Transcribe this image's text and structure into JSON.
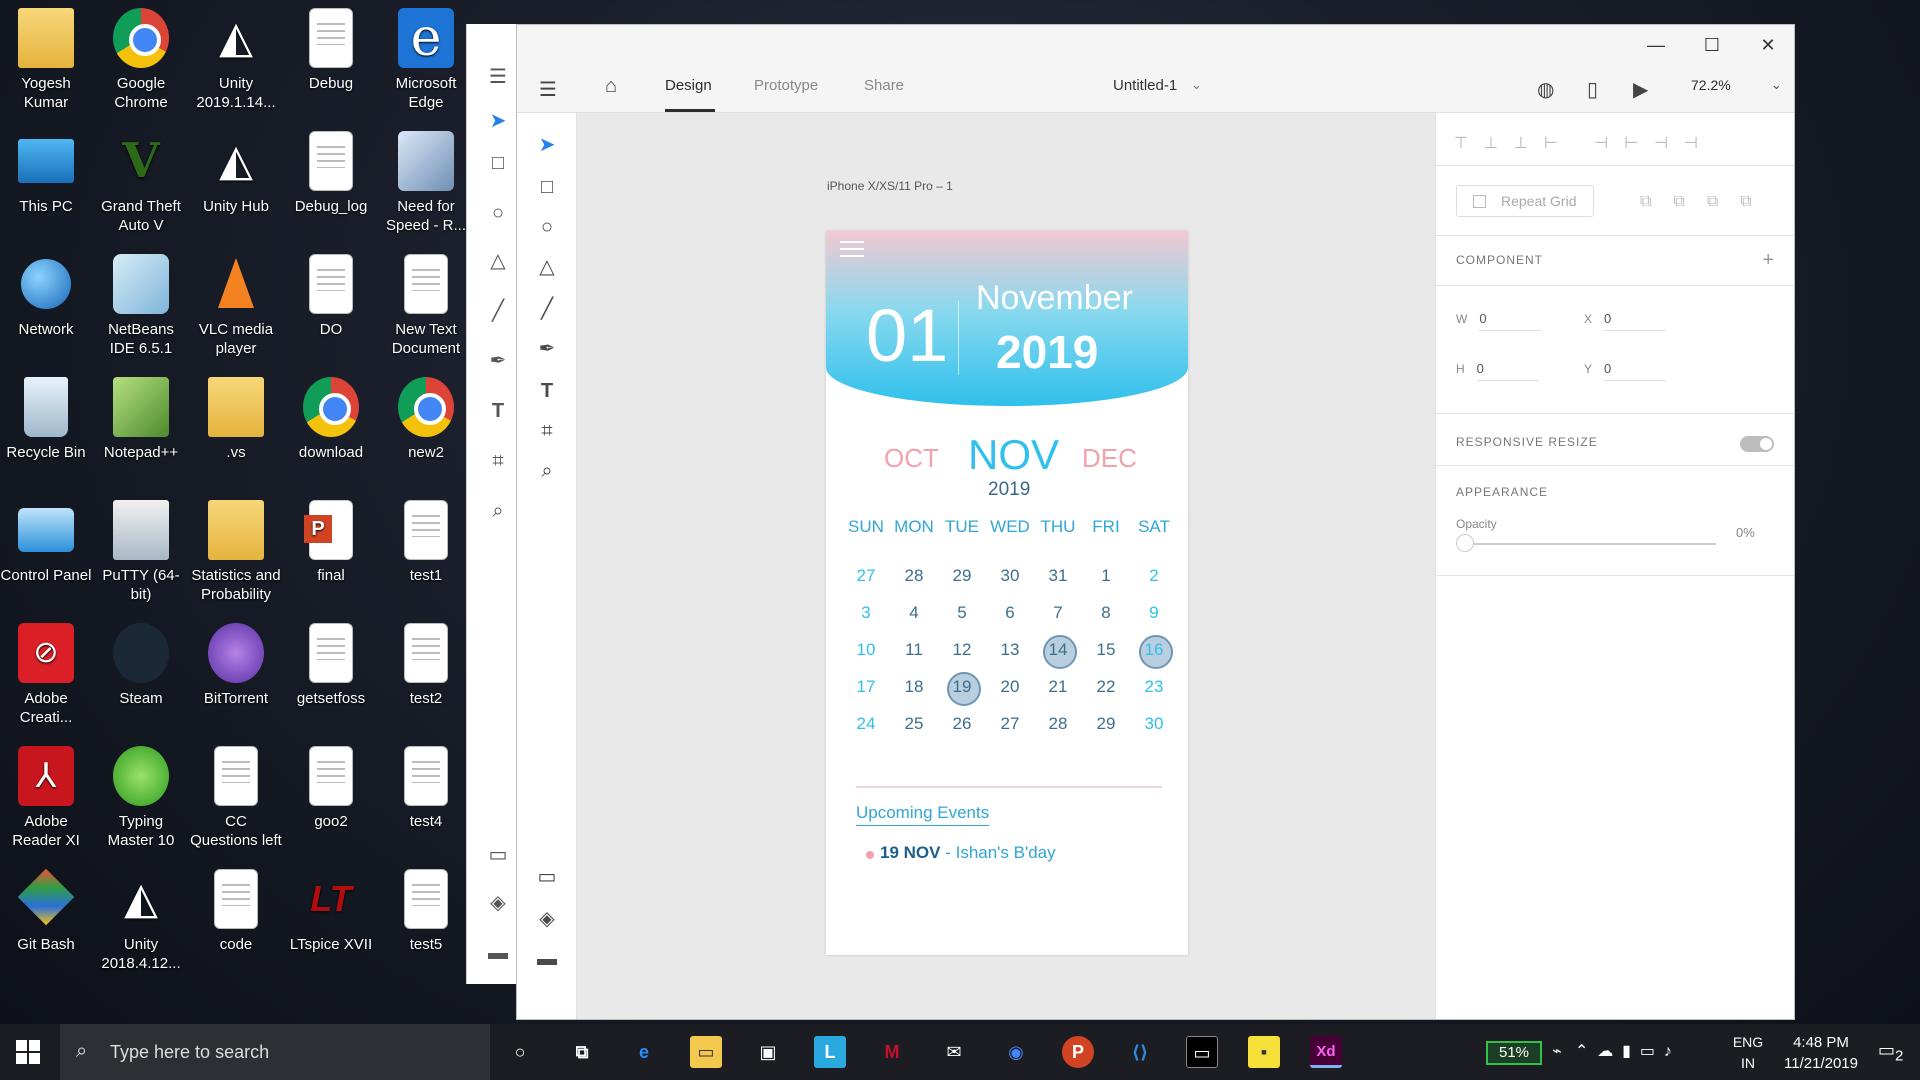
{
  "desktop": {
    "icons": [
      {
        "label": "Yogesh Kumar",
        "icon": "user-folder-icon",
        "col": 0,
        "row": 0
      },
      {
        "label": "Google Chrome",
        "icon": "chrome-icon",
        "col": 1,
        "row": 0
      },
      {
        "label": "Unity 2019.1.14...",
        "icon": "unity-icon",
        "col": 2,
        "row": 0
      },
      {
        "label": "Debug",
        "icon": "document-icon",
        "col": 3,
        "row": 0
      },
      {
        "label": "Microsoft Edge",
        "icon": "edge-icon",
        "col": 4,
        "row": 0
      },
      {
        "label": "This PC",
        "icon": "pc-icon",
        "col": 0,
        "row": 1
      },
      {
        "label": "Grand Theft Auto V",
        "icon": "gta-icon",
        "col": 1,
        "row": 1
      },
      {
        "label": "Unity Hub",
        "icon": "unity-icon",
        "col": 2,
        "row": 1
      },
      {
        "label": "Debug_log",
        "icon": "document-icon",
        "col": 3,
        "row": 1
      },
      {
        "label": "Need for Speed - R...",
        "icon": "nfs-icon",
        "col": 4,
        "row": 1
      },
      {
        "label": "Network",
        "icon": "network-icon",
        "col": 0,
        "row": 2
      },
      {
        "label": "NetBeans IDE 6.5.1",
        "icon": "netbeans-icon",
        "col": 1,
        "row": 2
      },
      {
        "label": "VLC media player",
        "icon": "vlc-icon",
        "col": 2,
        "row": 2
      },
      {
        "label": "DO",
        "icon": "document-icon",
        "col": 3,
        "row": 2
      },
      {
        "label": "New Text Document",
        "icon": "document-icon",
        "col": 4,
        "row": 2
      },
      {
        "label": "Recycle Bin",
        "icon": "recycle-bin-icon",
        "col": 0,
        "row": 3
      },
      {
        "label": "Notepad++",
        "icon": "notepadpp-icon",
        "col": 1,
        "row": 3
      },
      {
        "label": ".vs",
        "icon": "folder-icon",
        "col": 2,
        "row": 3
      },
      {
        "label": "download",
        "icon": "chrome-icon",
        "col": 3,
        "row": 3
      },
      {
        "label": "new2",
        "icon": "chrome-icon",
        "col": 4,
        "row": 3
      },
      {
        "label": "Control Panel",
        "icon": "control-panel-icon",
        "col": 0,
        "row": 4
      },
      {
        "label": "PuTTY (64-bit)",
        "icon": "putty-icon",
        "col": 1,
        "row": 4
      },
      {
        "label": "Statistics and Probability",
        "icon": "folder-icon",
        "col": 2,
        "row": 4
      },
      {
        "label": "final",
        "icon": "powerpoint-icon",
        "col": 3,
        "row": 4
      },
      {
        "label": "test1",
        "icon": "document-icon",
        "col": 4,
        "row": 4
      },
      {
        "label": "Adobe Creati...",
        "icon": "adobe-cc-icon",
        "col": 0,
        "row": 5
      },
      {
        "label": "Steam",
        "icon": "steam-icon",
        "col": 1,
        "row": 5
      },
      {
        "label": "BitTorrent",
        "icon": "bittorrent-icon",
        "col": 2,
        "row": 5
      },
      {
        "label": "getsetfoss",
        "icon": "document-icon",
        "col": 3,
        "row": 5
      },
      {
        "label": "test2",
        "icon": "document-icon",
        "col": 4,
        "row": 5
      },
      {
        "label": "Adobe Reader XI",
        "icon": "adobe-reader-icon",
        "col": 0,
        "row": 6
      },
      {
        "label": "Typing Master 10",
        "icon": "typing-master-icon",
        "col": 1,
        "row": 6
      },
      {
        "label": "CC Questions left",
        "icon": "document-icon",
        "col": 2,
        "row": 6
      },
      {
        "label": "goo2",
        "icon": "document-icon",
        "col": 3,
        "row": 6
      },
      {
        "label": "test4",
        "icon": "document-icon",
        "col": 4,
        "row": 6
      },
      {
        "label": "Git Bash",
        "icon": "git-icon",
        "col": 0,
        "row": 7
      },
      {
        "label": "Unity 2018.4.12...",
        "icon": "unity-icon",
        "col": 1,
        "row": 7
      },
      {
        "label": "code",
        "icon": "document-icon",
        "col": 2,
        "row": 7
      },
      {
        "label": "LTspice XVII",
        "icon": "ltspice-icon",
        "col": 3,
        "row": 7
      },
      {
        "label": "test5",
        "icon": "document-icon",
        "col": 4,
        "row": 7
      }
    ]
  },
  "xd": {
    "tabs": {
      "design": "Design",
      "prototype": "Prototype",
      "share": "Share"
    },
    "doc_title": "Untitled-1",
    "zoom": "72.2%",
    "artboard_name": "iPhone X/XS/11 Pro – 1",
    "calendar": {
      "day": "01",
      "month": "November",
      "year": "2019",
      "prev_month": "OCT",
      "cur_month": "NOV",
      "next_month": "DEC",
      "cur_year": "2019",
      "weekdays": [
        "SUN",
        "MON",
        "TUE",
        "WED",
        "THU",
        "FRI",
        "SAT"
      ],
      "weeks": [
        [
          "27",
          "28",
          "29",
          "30",
          "31",
          "1",
          "2"
        ],
        [
          "3",
          "4",
          "5",
          "6",
          "7",
          "8",
          "9"
        ],
        [
          "10",
          "11",
          "12",
          "13",
          "14",
          "15",
          "16"
        ],
        [
          "17",
          "18",
          "19",
          "20",
          "21",
          "22",
          "23"
        ],
        [
          "24",
          "25",
          "26",
          "27",
          "28",
          "29",
          "30"
        ]
      ],
      "upcoming_title": "Upcoming Events",
      "event_date": "19 NOV",
      "event_text": " - Ishan's B'day"
    },
    "props": {
      "repeat_grid": "Repeat Grid",
      "component": "COMPONENT",
      "w_label": "W",
      "w_value": "0",
      "h_label": "H",
      "h_value": "0",
      "x_label": "X",
      "x_value": "0",
      "y_label": "Y",
      "y_value": "0",
      "responsive": "RESPONSIVE RESIZE",
      "appearance": "APPEARANCE",
      "opacity_label": "Opacity",
      "opacity_value": "0%"
    }
  },
  "taskbar": {
    "search_placeholder": "Type here to search",
    "battery": "51%",
    "lang1": "ENG",
    "lang2": "IN",
    "time": "4:48 PM",
    "date": "11/21/2019",
    "notifications": "2"
  }
}
